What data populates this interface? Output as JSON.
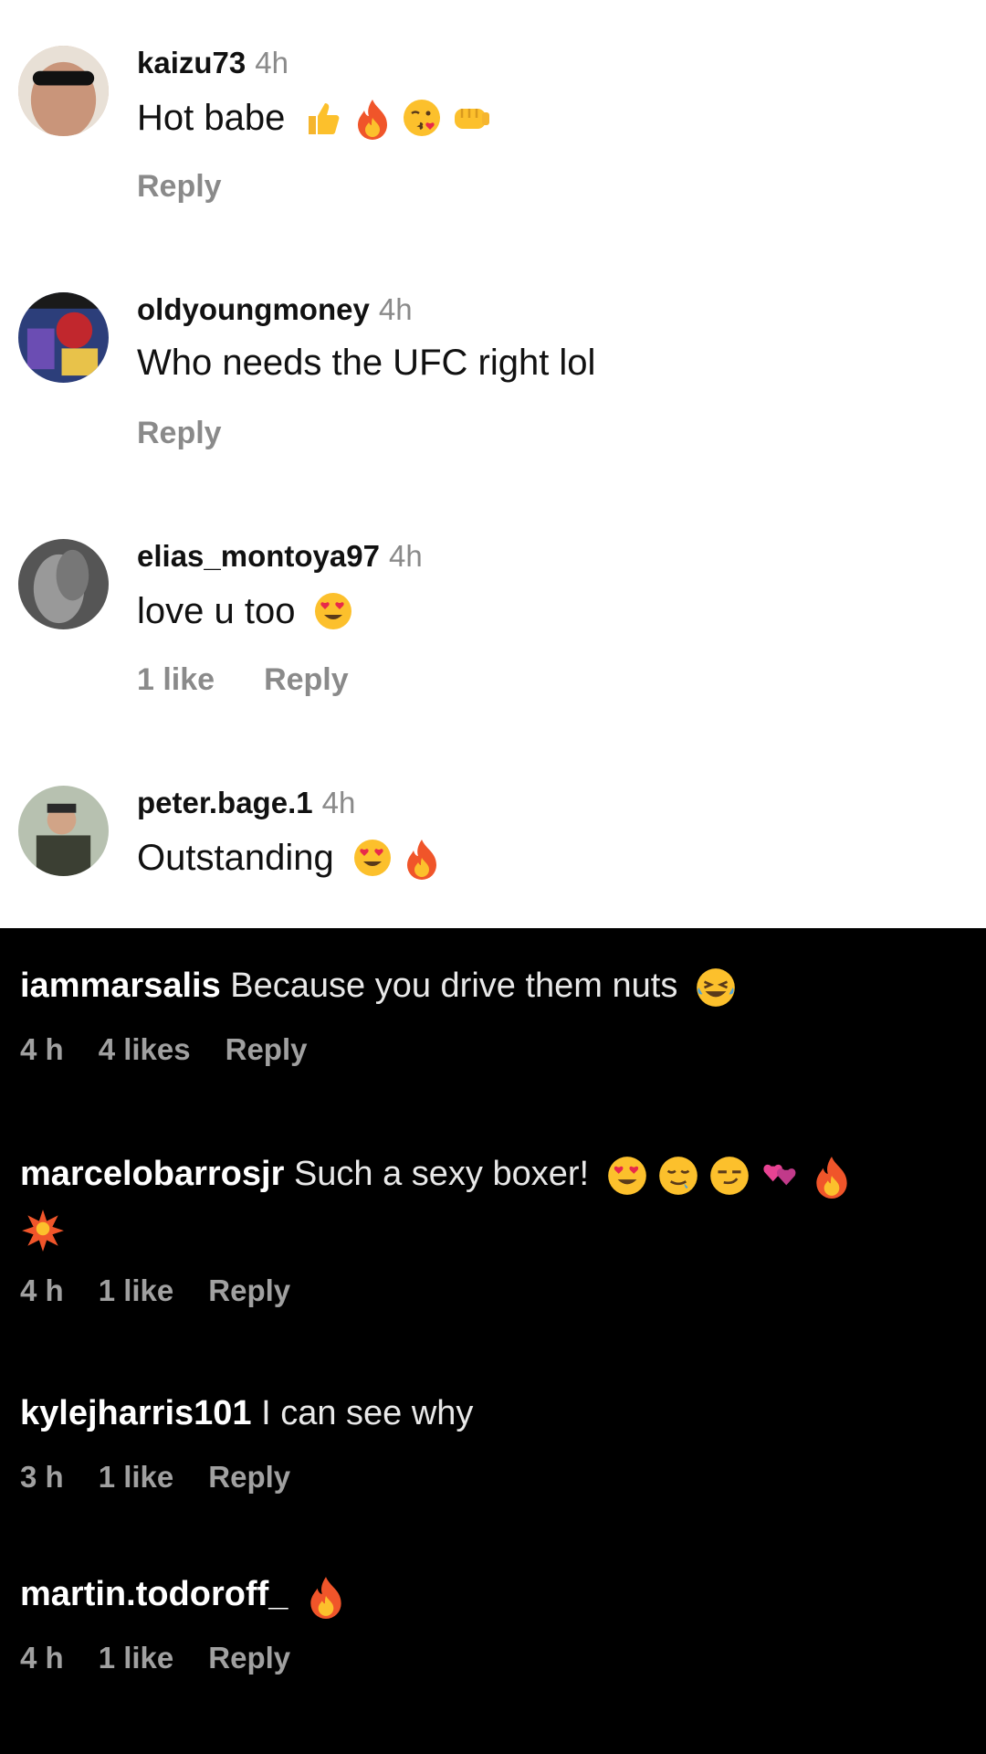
{
  "light_comments": [
    {
      "username": "kaizu73",
      "time": "4h",
      "text": "Hot babe",
      "emojis": [
        "thumbs-up-icon",
        "fire-icon",
        "kissing-face-icon",
        "fist-bump-icon"
      ],
      "likes": "",
      "reply": "Reply"
    },
    {
      "username": "oldyoungmoney",
      "time": "4h",
      "text": "Who needs the UFC right lol",
      "emojis": [],
      "likes": "",
      "reply": "Reply"
    },
    {
      "username": "elias_montoya97",
      "time": "4h",
      "text": "love u too",
      "emojis": [
        "heart-eyes-face-icon"
      ],
      "likes": "1 like",
      "reply": "Reply"
    },
    {
      "username": "peter.bage.1",
      "time": "4h",
      "text": "Outstanding",
      "emojis": [
        "heart-eyes-face-icon",
        "fire-icon"
      ],
      "likes": "",
      "reply": ""
    }
  ],
  "dark_comments": [
    {
      "username": "iammarsalis",
      "text": "Because you drive them nuts",
      "emojis": [
        "laughing-tears-face-icon"
      ],
      "time": "4 h",
      "likes": "4 likes",
      "reply": "Reply"
    },
    {
      "username": "marcelobarrosjr",
      "text": "Such a sexy boxer!",
      "emojis": [
        "heart-eyes-face-icon",
        "drooling-face-icon",
        "smirk-face-icon",
        "two-hearts-icon",
        "fire-icon",
        "collision-icon"
      ],
      "time": "4 h",
      "likes": "1 like",
      "reply": "Reply"
    },
    {
      "username": "kylejharris101",
      "text": "I can see why",
      "emojis": [],
      "time": "3 h",
      "likes": "1 like",
      "reply": "Reply"
    },
    {
      "username": "martin.todoroff_",
      "text": "",
      "emojis": [
        "fire-icon"
      ],
      "time": "4 h",
      "likes": "1 like",
      "reply": "Reply"
    }
  ],
  "colors": {
    "light_bg": "#ffffff",
    "dark_bg": "#000000",
    "muted_text": "#8a8a8a",
    "dark_muted_text": "#a0a0a0"
  }
}
